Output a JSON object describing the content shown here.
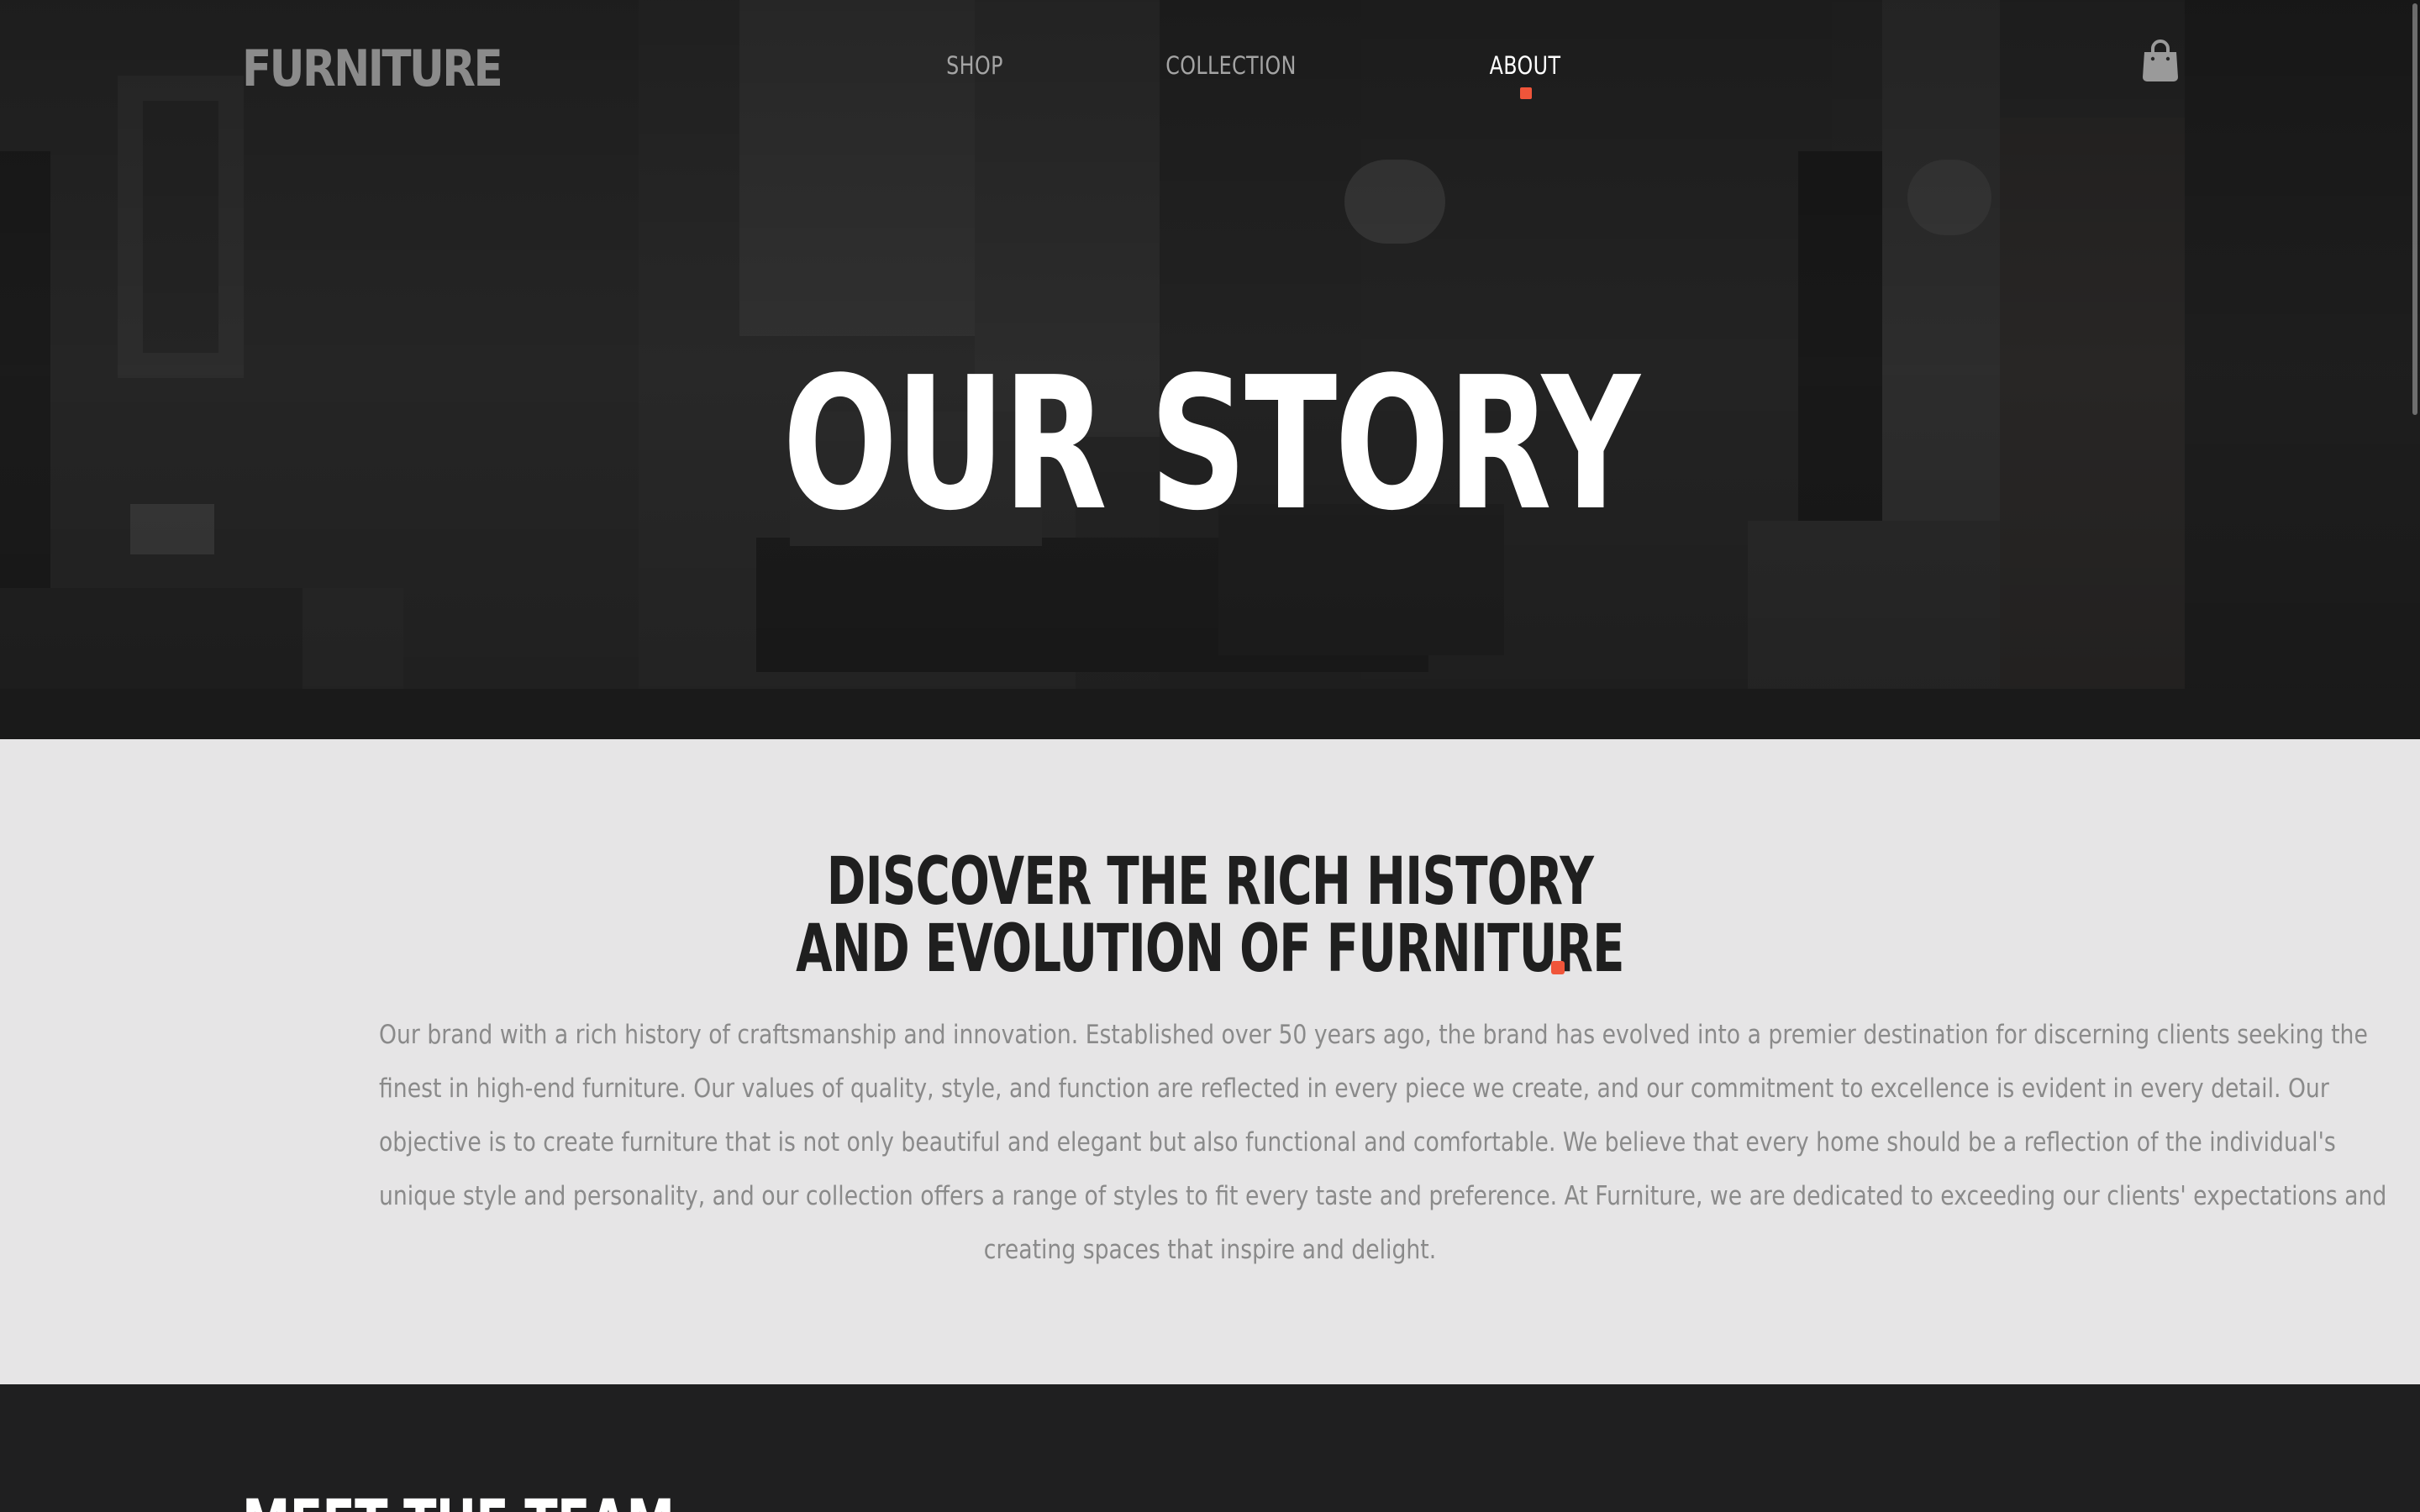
{
  "brand": {
    "logo": "FURNITURE"
  },
  "nav": {
    "links": [
      {
        "label": "SHOP",
        "active": false
      },
      {
        "label": "COLLECTION",
        "active": false
      },
      {
        "label": "ABOUT",
        "active": true
      }
    ],
    "cart_icon": "shopping-bag-icon",
    "active_indicator_color": "#f0553a"
  },
  "hero": {
    "title": "OUR STORY"
  },
  "about": {
    "heading_lines": [
      "DISCOVER THE RICH HISTORY",
      "AND EVOLUTION OF FURNITURE"
    ],
    "accent_color": "#f0553a",
    "body_lines": [
      "Our brand with a rich history of craftsmanship and innovation. Established over 50 years ago, the brand has evolved into a premier destination for discerning clients seeking the",
      "finest in high-end furniture. Our values of quality, style, and function are reflected in every piece we create, and our commitment to excellence is evident in every detail. Our",
      "objective is to create furniture that is not only beautiful and elegant but also functional and comfortable. We believe that every home should be a reflection of the individual's",
      "unique style and personality, and our collection offers a range of styles to fit every taste and preference. At Furniture, we are dedicated to exceeding our clients' expectations and",
      "creating spaces that inspire and delight."
    ]
  },
  "team": {
    "title": "MEET THE TEAM"
  }
}
